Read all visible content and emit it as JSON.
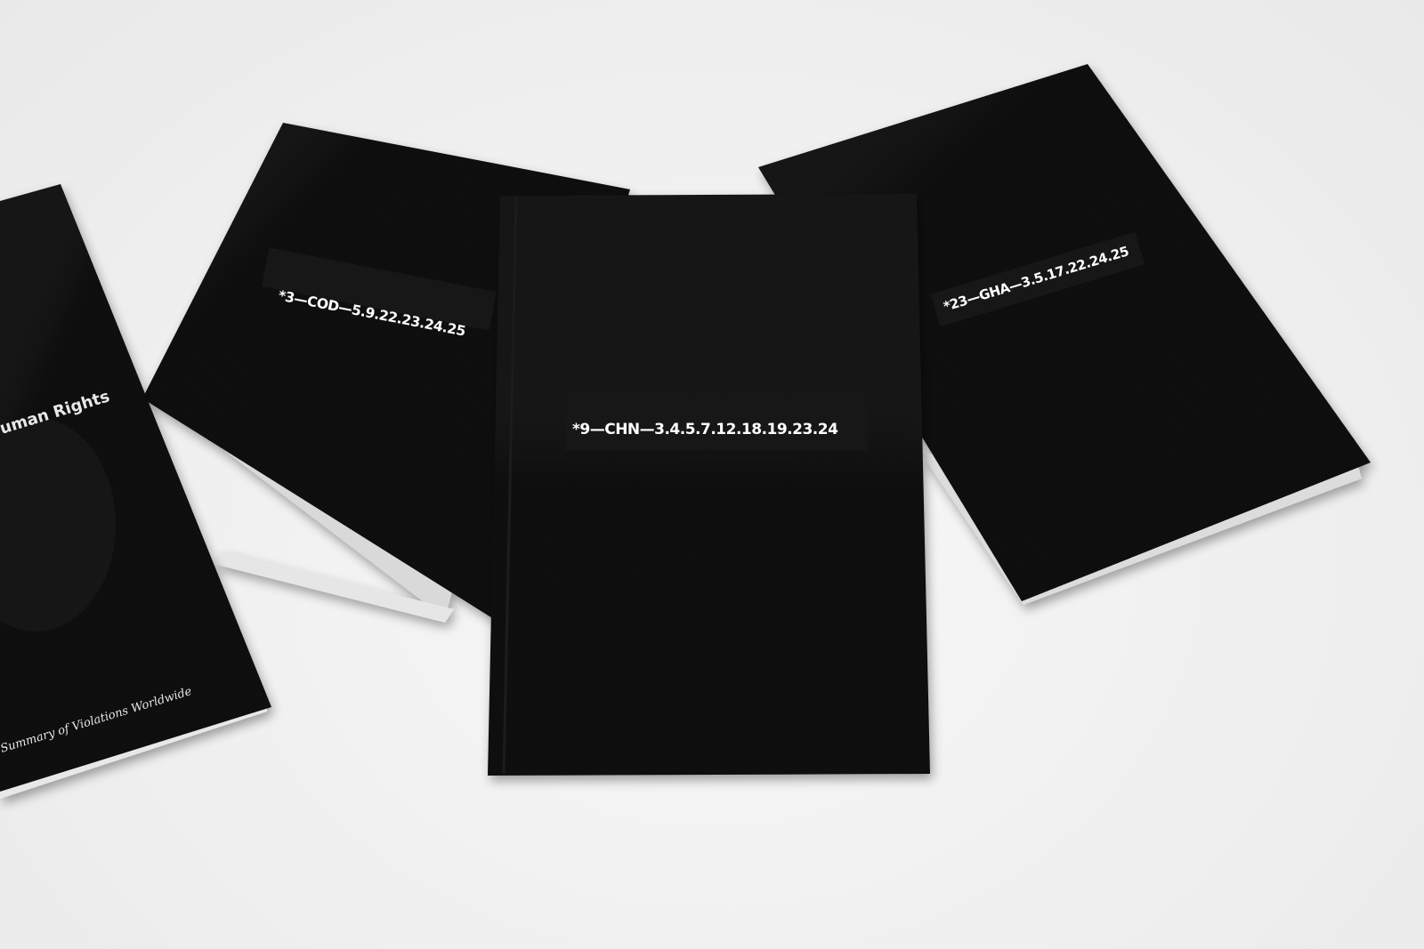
{
  "scene": {
    "description_tag": "photo",
    "background_color": "#efefef"
  },
  "books": [
    {
      "id": "left-book",
      "title_fragment": "uman Rights",
      "subtitle_fragment": "Summary of Violations Worldwide"
    },
    {
      "id": "back-left-book",
      "code": "*3—COD—5.9.22.23.24.25"
    },
    {
      "id": "center-book",
      "code": "*9—CHN—3.4.5.7.12.18.19.23.24"
    },
    {
      "id": "right-book",
      "code": "*23—GHA—3.5.17.22.24.25"
    }
  ],
  "colors": {
    "cover": "#0c0c0c",
    "cover_center": "#111111",
    "pages": "#f4f4f4",
    "text": "#ffffff"
  }
}
